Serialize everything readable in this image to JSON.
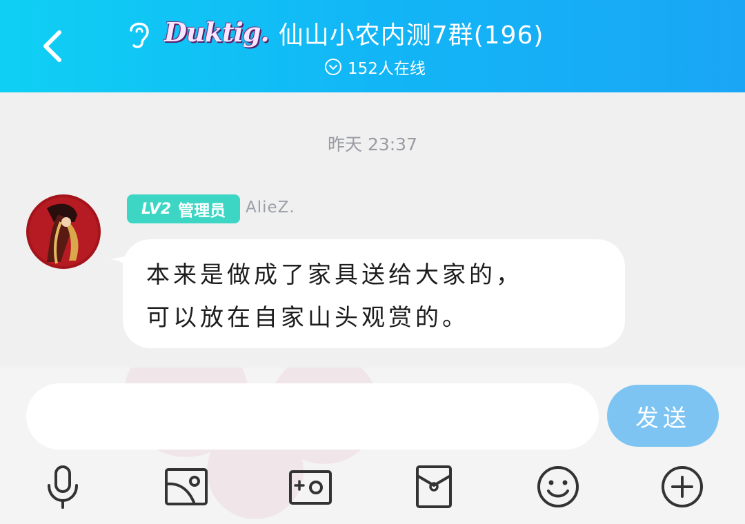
{
  "header": {
    "logo_text": "Duktig.",
    "group_title": "仙山小农内测7群(196)",
    "online_text": "152人在线"
  },
  "chat": {
    "timestamp": "昨天 23:37",
    "message": {
      "level": "LV2",
      "role": "管理员",
      "username": "AlieZ.",
      "text_line1": "本来是做成了家具送给大家的，",
      "text_line2": "可以放在自家山头观赏的。"
    }
  },
  "composer": {
    "input_value": "",
    "input_placeholder": "",
    "send_label": "发送"
  },
  "toolbar": {
    "icons": [
      "microphone-icon",
      "image-icon",
      "camera-icon",
      "red-packet-icon",
      "emoji-icon",
      "plus-icon"
    ]
  },
  "colors": {
    "header_start": "#0fd0f4",
    "header_end": "#1aa6f5",
    "badge": "#3dd6c4",
    "send_button": "#7dc4f2",
    "background": "#f0f0f0"
  }
}
